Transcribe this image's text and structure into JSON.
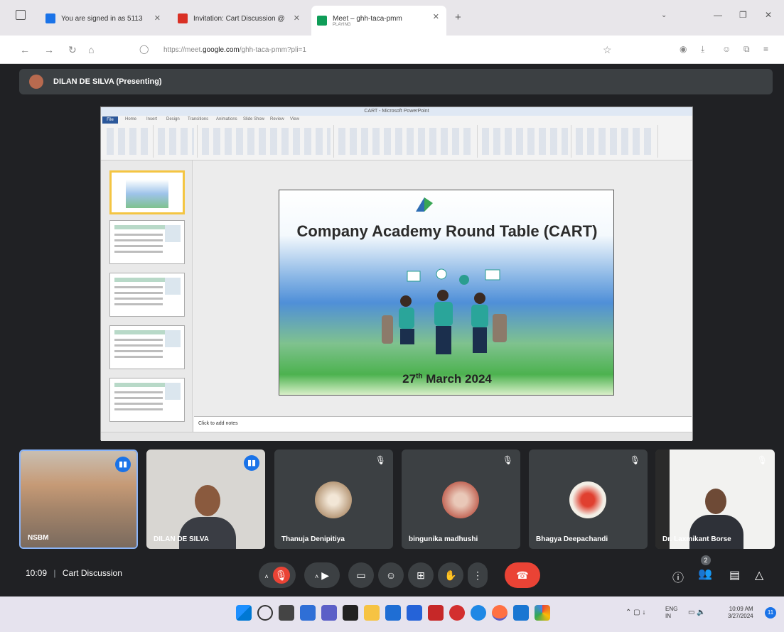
{
  "browser": {
    "tabs": [
      {
        "label": "You are signed in as 5113",
        "fav_color": "#1a73e8"
      },
      {
        "label": "Invitation: Cart Discussion @",
        "fav_color": "#d93025"
      },
      {
        "label": "Meet – ghh-taca-pmm",
        "sub": "PLAYING",
        "fav_color": "#0f9d58"
      }
    ],
    "url_prefix": "https://meet.",
    "url_domain": "google.com",
    "url_suffix": "/ghh-taca-pmm?pli=1"
  },
  "meet": {
    "presenter_label": "DILAN DE SILVA (Presenting)",
    "time": "10:09",
    "meeting_title": "Cart Discussion",
    "participants_count": "2"
  },
  "powerpoint": {
    "window_title": "CART - Microsoft PowerPoint",
    "file_tab": "File",
    "ribbon_tabs": [
      "Home",
      "Insert",
      "Design",
      "Transitions",
      "Animations",
      "Slide Show",
      "Review",
      "View"
    ],
    "notes_placeholder": "Click to add notes",
    "slide_title": "Company Academy Round Table (CART)",
    "slide_date_day": "27",
    "slide_date_sup": "th",
    "slide_date_rest": " March 2024"
  },
  "tiles": [
    {
      "name": "NSBM",
      "speaking": true
    },
    {
      "name": "DILAN DE SILVA",
      "speaking": true
    },
    {
      "name": "Thanuja Denipitiya",
      "speaking": false
    },
    {
      "name": "bingunika madhushi",
      "speaking": false
    },
    {
      "name": "Bhagya Deepachandi",
      "speaking": false
    },
    {
      "name": "Dr. Laxmikant Borse",
      "speaking": false
    }
  ],
  "taskbar": {
    "lang_top": "ENG",
    "lang_bottom": "IN",
    "clock_time": "10:09 AM",
    "clock_date": "3/27/2024",
    "notif_count": "11"
  },
  "colors": {
    "meet_bg": "#202124",
    "tile_bg": "#3c4043",
    "accent_blue": "#1a73e8",
    "end_call_red": "#ea4335"
  }
}
